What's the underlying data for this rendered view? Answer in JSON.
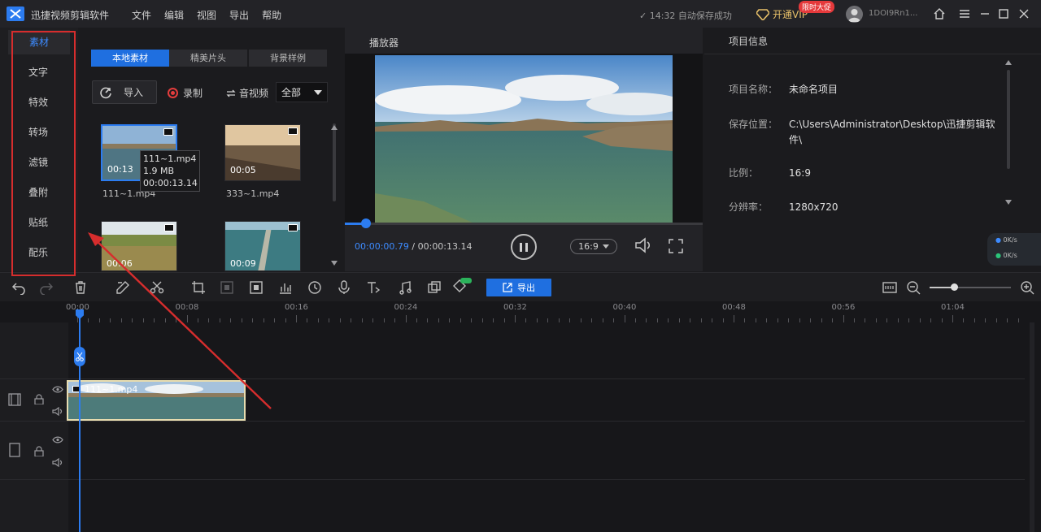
{
  "app": {
    "title": "迅捷视频剪辑软件",
    "menu": [
      "文件",
      "编辑",
      "视图",
      "导出",
      "帮助"
    ],
    "autosave": "✓ 14:32 自动保存成功",
    "vip_label": "开通VIP",
    "vip_badge": "限时大促",
    "username": "1DOI9Rn1..."
  },
  "sidebar": {
    "items": [
      {
        "label": "素材",
        "active": true
      },
      {
        "label": "文字"
      },
      {
        "label": "特效"
      },
      {
        "label": "转场"
      },
      {
        "label": "滤镜"
      },
      {
        "label": "叠附"
      },
      {
        "label": "贴纸"
      },
      {
        "label": "配乐"
      }
    ]
  },
  "media": {
    "tabs": [
      "本地素材",
      "精美片头",
      "背景样例"
    ],
    "import_label": "导入",
    "record_label": "录制",
    "convert_label": "音视频",
    "filter_value": "全部",
    "items": [
      {
        "name": "111~1.mp4",
        "duration": "00:13"
      },
      {
        "name": "333~1.mp4",
        "duration": "00:05"
      },
      {
        "name": "",
        "duration": "00:06"
      },
      {
        "name": "",
        "duration": "00:09"
      }
    ],
    "tooltip": {
      "name": "111~1.mp4",
      "size": "1.9 MB",
      "duration": "00:00:13.14"
    }
  },
  "player": {
    "title": "播放器",
    "current_time": "00:00:00.79",
    "separator": " / ",
    "total_time": "00:00:13.14",
    "progress": 0.06,
    "ratio": "16:9"
  },
  "project": {
    "title": "项目信息",
    "rows": [
      {
        "key": "项目名称：",
        "value": "未命名项目"
      },
      {
        "key": "保存位置：",
        "value": "C:\\Users\\Administrator\\Desktop\\迅捷剪辑软"
      },
      {
        "key": "",
        "value": "件\\"
      },
      {
        "key": "比例：",
        "value": "16:9"
      },
      {
        "key": "分辨率：",
        "value": "1280x720"
      }
    ]
  },
  "net": {
    "up": "0K/s",
    "down": "0K/s"
  },
  "toolbar": {
    "export_label": "导出",
    "zoom_level": 0.3
  },
  "timeline": {
    "ticks": [
      "00:00",
      "00:08",
      "00:16",
      "00:24",
      "00:32",
      "00:40",
      "00:48",
      "00:56",
      "01:04"
    ],
    "clip_label": "111~1.mp4"
  },
  "colors": {
    "accent": "#2c7cf0",
    "highlight_box": "#d62d2d",
    "vip_gold": "#e7c069"
  }
}
